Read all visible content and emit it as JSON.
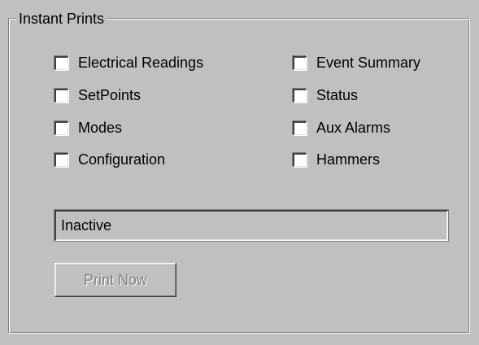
{
  "group": {
    "title": "Instant Prints"
  },
  "options": {
    "left": [
      {
        "label": "Electrical Readings",
        "checked": false
      },
      {
        "label": "SetPoints",
        "checked": false
      },
      {
        "label": "Modes",
        "checked": false
      },
      {
        "label": "Configuration",
        "checked": false
      }
    ],
    "right": [
      {
        "label": "Event Summary",
        "checked": false
      },
      {
        "label": "Status",
        "checked": false
      },
      {
        "label": "Aux Alarms",
        "checked": false
      },
      {
        "label": "Hammers",
        "checked": false
      }
    ]
  },
  "status": {
    "value": "Inactive"
  },
  "actions": {
    "print_now_label": "Print Now",
    "print_now_enabled": false
  },
  "colors": {
    "face": "#c0c0c0",
    "disabled_text": "#808080"
  }
}
